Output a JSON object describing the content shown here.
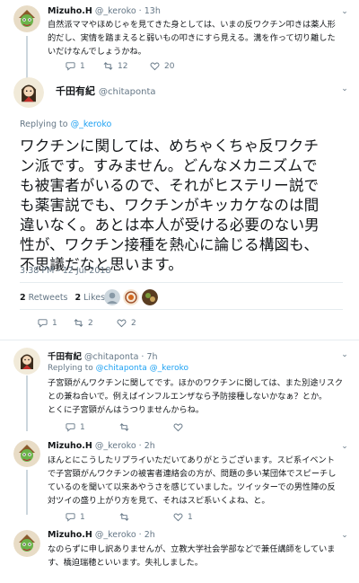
{
  "tweets": {
    "t1": {
      "name": "Mizuho.H",
      "handle": "@_keroko",
      "sep": "·",
      "time": "13h",
      "text_lines": [
        "自然派ママやほめじゃを見てきた身としては、いまの反ワクチン叩きは薬人形",
        "的だし、実情を踏まえると弱いもの叩きにすら見える。溝を作って切り離した",
        "いだけなんでしょうかね。"
      ],
      "replies": "1",
      "retweets": "12",
      "likes": "20"
    },
    "main": {
      "name": "千田有紀",
      "handle": "@chitaponta",
      "reply_prefix": "Replying to",
      "reply_to": "@_keroko",
      "text_lines": [
        "ワクチンに関しては、めちゃくちゃ反ワクチ",
        "ン派です。すみません。どんなメカニズムで",
        "も被害者がいるので、それがヒステリー説で",
        "も薬害説でも、ワクチンがキッカケなのは間",
        "違いなく。あとは本人が受ける必要のない男",
        "性が、ワクチン接種を熱心に論じる構図も、",
        "不思議だなと思います。"
      ],
      "timestamp": "3:38 PM - 12 Jul 2018",
      "retweets_count": "2",
      "retweets_label": "Retweets",
      "likes_count": "2",
      "likes_label": "Likes",
      "replies": "1",
      "retweets": "2",
      "likes": "2"
    },
    "t3": {
      "name": "千田有紀",
      "handle": "@chitaponta",
      "sep": "·",
      "time": "7h",
      "reply_prefix": "Replying to",
      "reply_to_1": "@chitaponta",
      "reply_to_2": "@_keroko",
      "text_lines": [
        "子宮頸がんワクチンに関してです。ほかのワクチンに関しては、また別途リスク",
        "との兼ね合いで。例えばインフルエンザなら予防接種しないかなぁ？とか。",
        "とくに子宮頸がんはうつりませんからね。"
      ],
      "replies": "1",
      "retweets": "",
      "likes": ""
    },
    "t4": {
      "name": "Mizuho.H",
      "handle": "@_keroko",
      "sep": "·",
      "time": "2h",
      "text_lines": [
        "ほんとにこうしたリプライいただいてありがとうございます。スピ系イベント",
        "で子宮頸がんワクチンの被害者連絡会の方が、問題の多い某団体でスピーチし",
        "ているのを聞いて以来あやうさを感じていました。ツイッターでの男性陣の反",
        "対ツイの盛り上がり方を見て、それはスピ系いくよね、と。"
      ],
      "replies": "1",
      "retweets": "",
      "likes": "1"
    },
    "t5": {
      "name": "Mizuho.H",
      "handle": "@_keroko",
      "sep": "·",
      "time": "2h",
      "text_lines": [
        "なのらずに申し訳ありませんが、立教大学社会学部などで兼任講師をしていま",
        "す、橋迫瑞穂といいます。失礼しました。"
      ]
    }
  },
  "icons": [
    "reply-icon",
    "retweet-icon",
    "heart-icon",
    "chevron-down-icon"
  ],
  "colors": {
    "link": "#1da1f2",
    "muted": "#657786",
    "text": "#14171a",
    "line": "#ccd6dd",
    "divider": "#e6ecf0"
  }
}
